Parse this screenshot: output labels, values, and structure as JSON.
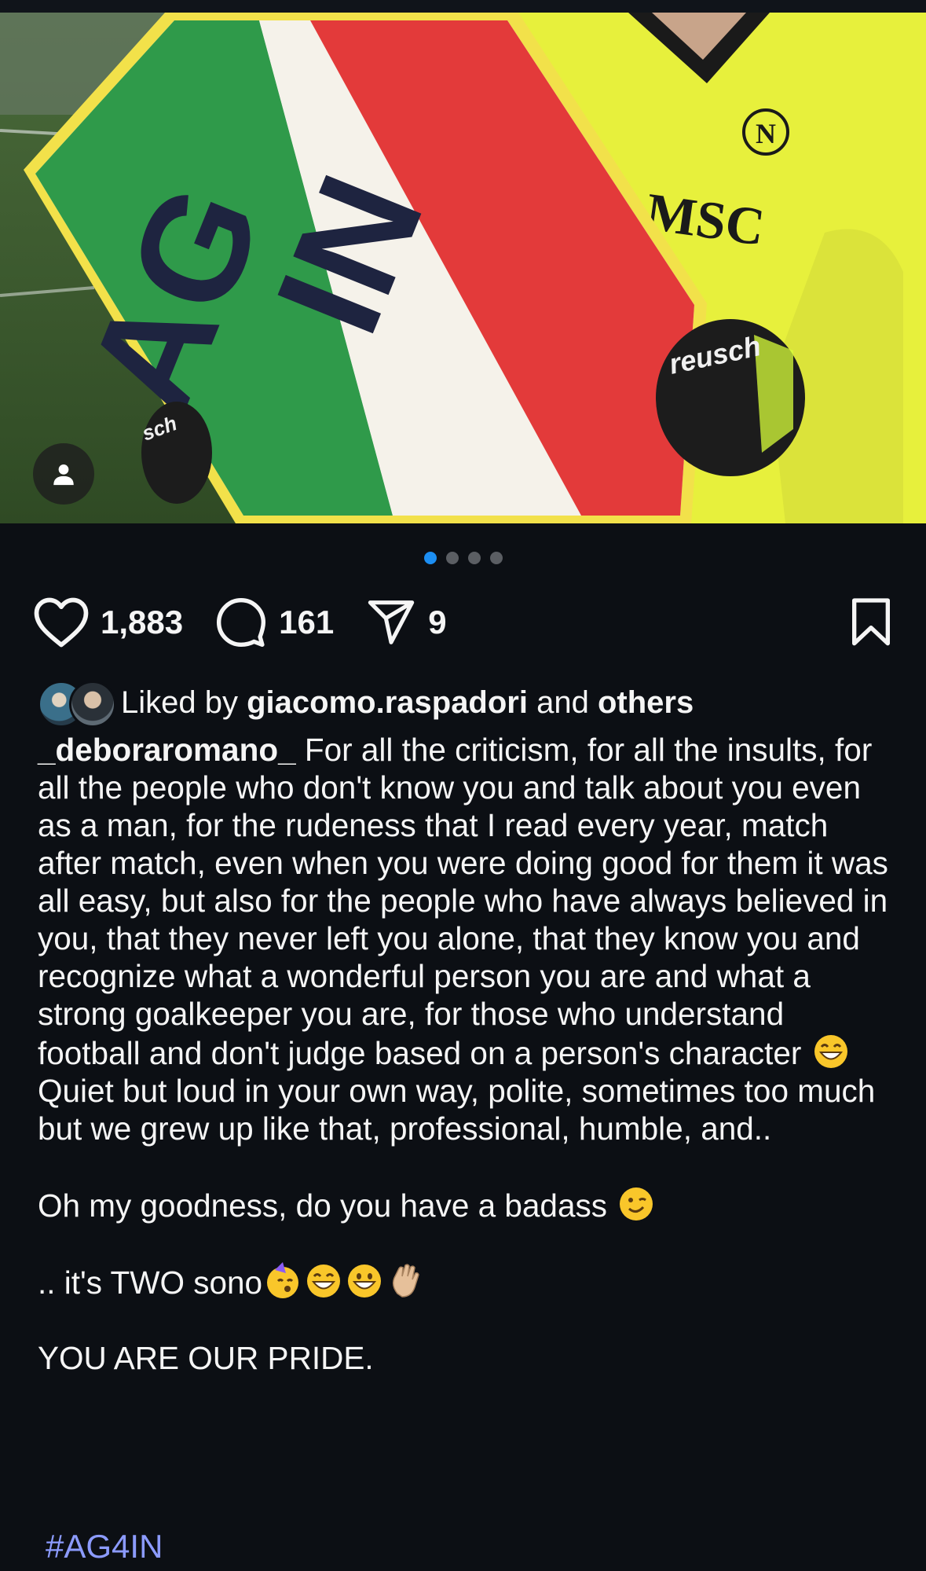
{
  "post": {
    "likes": "1,883",
    "comments": "161",
    "shares": "9",
    "carousel": {
      "count": 4,
      "active": 0
    }
  },
  "liked_by": {
    "prefix": "Liked by ",
    "user": "giacomo.raspadori",
    "mid": " and ",
    "others": "others"
  },
  "caption": {
    "username": "_deboraromano_",
    "p1": " For all the criticism, for all the insults, for all the people who don't know you and talk about you even as a man, for the rudeness that I read every year, match after match, even when you were doing good for them it was all easy, but also for the people who have always believed in you, that they never left you alone, that they know you and recognize what a wonderful person you are and what a strong goalkeeper you are, for those who understand football and don't judge based on a person's character ",
    "p2": "Quiet but loud in your own way, polite, sometimes too much but we grew up like that, professional, humble, and..",
    "p3": "Oh my goodness, do you have a badass ",
    "p4": ".. it's TWO sono",
    "p5": "YOU ARE OUR PRIDE.",
    "hashtag": "#AG4IN"
  },
  "photo": {
    "sign_text_1": "AG",
    "sign_text_2": "IN",
    "sponsor": "MSC",
    "glove_brand": "reusch",
    "glove_brand_short": "sch",
    "badge": "N"
  },
  "colors": {
    "background": "#0c0f14",
    "active_dot": "#1c8ef2",
    "hashtag": "#8c9bff",
    "jersey": "#e7f03c",
    "flag_green": "#2f9a4a",
    "flag_red": "#e33a3a",
    "sign_letters": "#1e2440"
  },
  "icons": [
    "heart-icon",
    "comment-icon",
    "share-icon",
    "bookmark-icon",
    "user-tag-icon"
  ]
}
